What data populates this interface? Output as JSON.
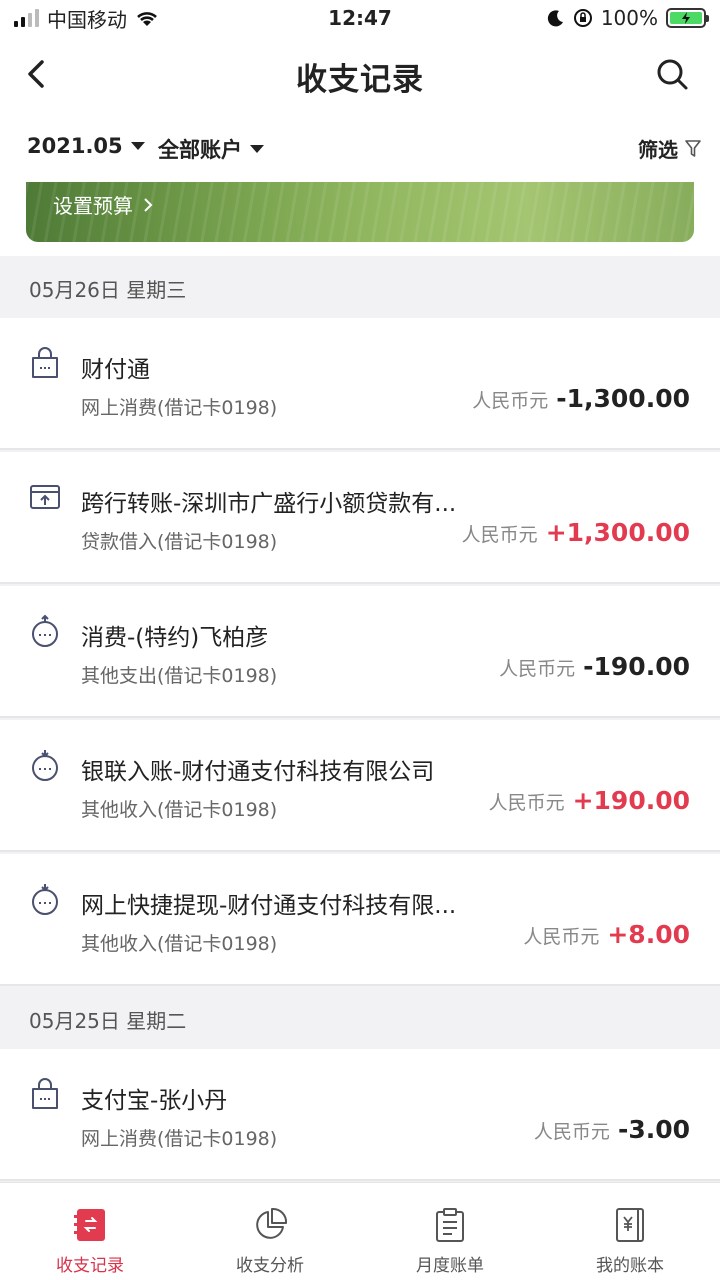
{
  "status_bar": {
    "carrier": "中国移动",
    "time": "12:47",
    "battery": "100%"
  },
  "nav": {
    "title": "收支记录"
  },
  "filter": {
    "month": "2021.05",
    "account": "全部账户",
    "filter_label": "筛选"
  },
  "banner": {
    "text": "设置预算"
  },
  "groups": [
    {
      "date": "05月26日 星期三",
      "items": [
        {
          "icon": "shopping-bag-icon",
          "title": "财付通",
          "subtitle": "网上消费(借记卡0198)",
          "currency": "人民币元",
          "amount": "-1,300.00",
          "type": "neg"
        },
        {
          "icon": "transfer-icon",
          "title": "跨行转账-深圳市广盛行小额贷款有...",
          "subtitle": "贷款借入(借记卡0198)",
          "currency": "人民币元",
          "amount": "+1,300.00",
          "type": "pos"
        },
        {
          "icon": "expense-face-icon",
          "title": "消费-(特约)飞柏彦",
          "subtitle": "其他支出(借记卡0198)",
          "currency": "人民币元",
          "amount": "-190.00",
          "type": "neg"
        },
        {
          "icon": "income-face-icon",
          "title": "银联入账-财付通支付科技有限公司",
          "subtitle": "其他收入(借记卡0198)",
          "currency": "人民币元",
          "amount": "+190.00",
          "type": "pos"
        },
        {
          "icon": "income-face-icon",
          "title": "网上快捷提现-财付通支付科技有限...",
          "subtitle": "其他收入(借记卡0198)",
          "currency": "人民币元",
          "amount": "+8.00",
          "type": "pos"
        }
      ]
    },
    {
      "date": "05月25日 星期二",
      "items": [
        {
          "icon": "shopping-bag-icon",
          "title": "支付宝-张小丹",
          "subtitle": "网上消费(借记卡0198)",
          "currency": "人民币元",
          "amount": "-3.00",
          "type": "neg"
        }
      ]
    }
  ],
  "tabs": [
    {
      "label": "收支记录",
      "active": true
    },
    {
      "label": "收支分析",
      "active": false
    },
    {
      "label": "月度账单",
      "active": false
    },
    {
      "label": "我的账本",
      "active": false
    }
  ],
  "colors": {
    "accent": "#e23b50",
    "tab_active": "#d9324a",
    "icon_stroke": "#4a5070"
  }
}
